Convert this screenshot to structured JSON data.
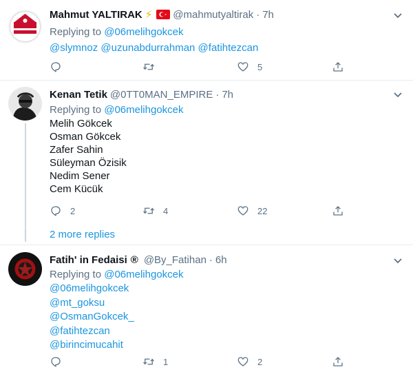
{
  "tweets": [
    {
      "name": "Mahmut YALTIRAK",
      "emoji": "⚡",
      "handle": "@mahmutyaltirak",
      "time": "7h",
      "replying_label": "Replying to",
      "replying_to": "@06melihgokcek",
      "body_lines": [
        "@slymnoz @uzunabdurrahman @fatihtezcan"
      ],
      "reply_count": "",
      "retweet_count": "",
      "like_count": "5",
      "avatar_text": "TÜRKİYE'YE"
    },
    {
      "name": "Kenan Tetik",
      "handle": "@0TT0MAN_EMPIRE",
      "time": "7h",
      "replying_label": "Replying to",
      "replying_to": "@06melihgokcek",
      "body_lines": [
        "Melih Gökcek",
        "Osman Gökcek",
        "Zafer Sahin",
        "Süleyman Özisik",
        "Nedim Sener",
        "Cem Kücük"
      ],
      "reply_count": "2",
      "retweet_count": "4",
      "like_count": "22",
      "more_replies": "2 more replies"
    },
    {
      "name": "Fatih' in Fedaisi",
      "badge": "®",
      "handle": "@By_Fatihan",
      "time": "6h",
      "replying_label": "Replying to",
      "replying_to": "@06melihgokcek",
      "body_lines": [
        "@mt_goksu",
        "@OsmanGokcek_",
        "@fatihtezcan",
        "@birincimucahit"
      ],
      "reply_count": "",
      "retweet_count": "1",
      "like_count": "2"
    }
  ],
  "colors": {
    "link": "#1b95e0",
    "muted": "#5b7083",
    "divider": "#e6ecf0",
    "flag": "#e30a17"
  }
}
